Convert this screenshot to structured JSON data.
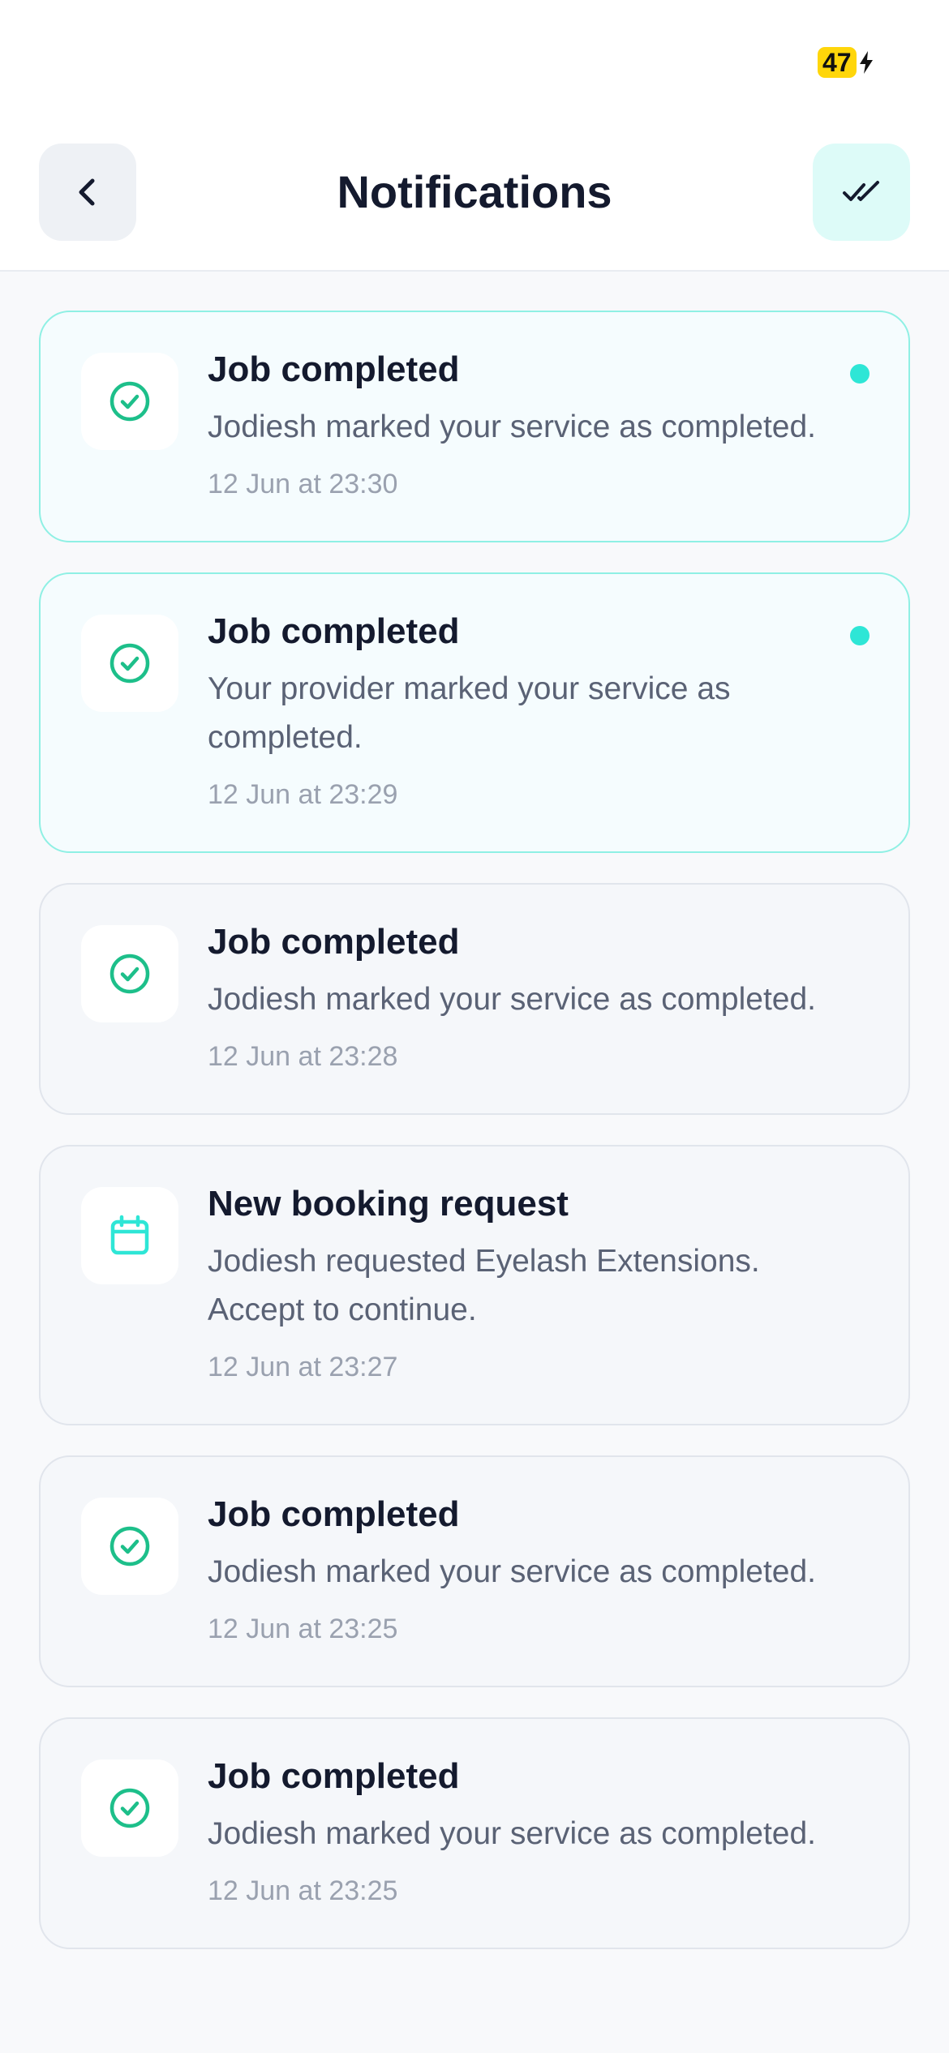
{
  "status_bar": {
    "battery_level": "47"
  },
  "header": {
    "title": "Notifications"
  },
  "colors": {
    "accent": "#2EE6D6",
    "success": "#1DBF8A",
    "unread_border": "#8FF0E4"
  },
  "notifications": [
    {
      "title": "Job completed",
      "body": "Jodiesh marked your service as completed.",
      "time": "12 Jun at 23:30",
      "icon": "check-circle-icon",
      "unread": true
    },
    {
      "title": "Job completed",
      "body": "Your provider marked your service as completed.",
      "time": "12 Jun at 23:29",
      "icon": "check-circle-icon",
      "unread": true
    },
    {
      "title": "Job completed",
      "body": "Jodiesh marked your service as completed.",
      "time": "12 Jun at 23:28",
      "icon": "check-circle-icon",
      "unread": false
    },
    {
      "title": "New booking request",
      "body": "Jodiesh requested Eyelash Extensions. Accept to continue.",
      "time": "12 Jun at 23:27",
      "icon": "calendar-icon",
      "unread": false
    },
    {
      "title": "Job completed",
      "body": "Jodiesh marked your service as completed.",
      "time": "12 Jun at 23:25",
      "icon": "check-circle-icon",
      "unread": false
    },
    {
      "title": "Job completed",
      "body": "Jodiesh marked your service as completed.",
      "time": "12 Jun at 23:25",
      "icon": "check-circle-icon",
      "unread": false
    }
  ]
}
